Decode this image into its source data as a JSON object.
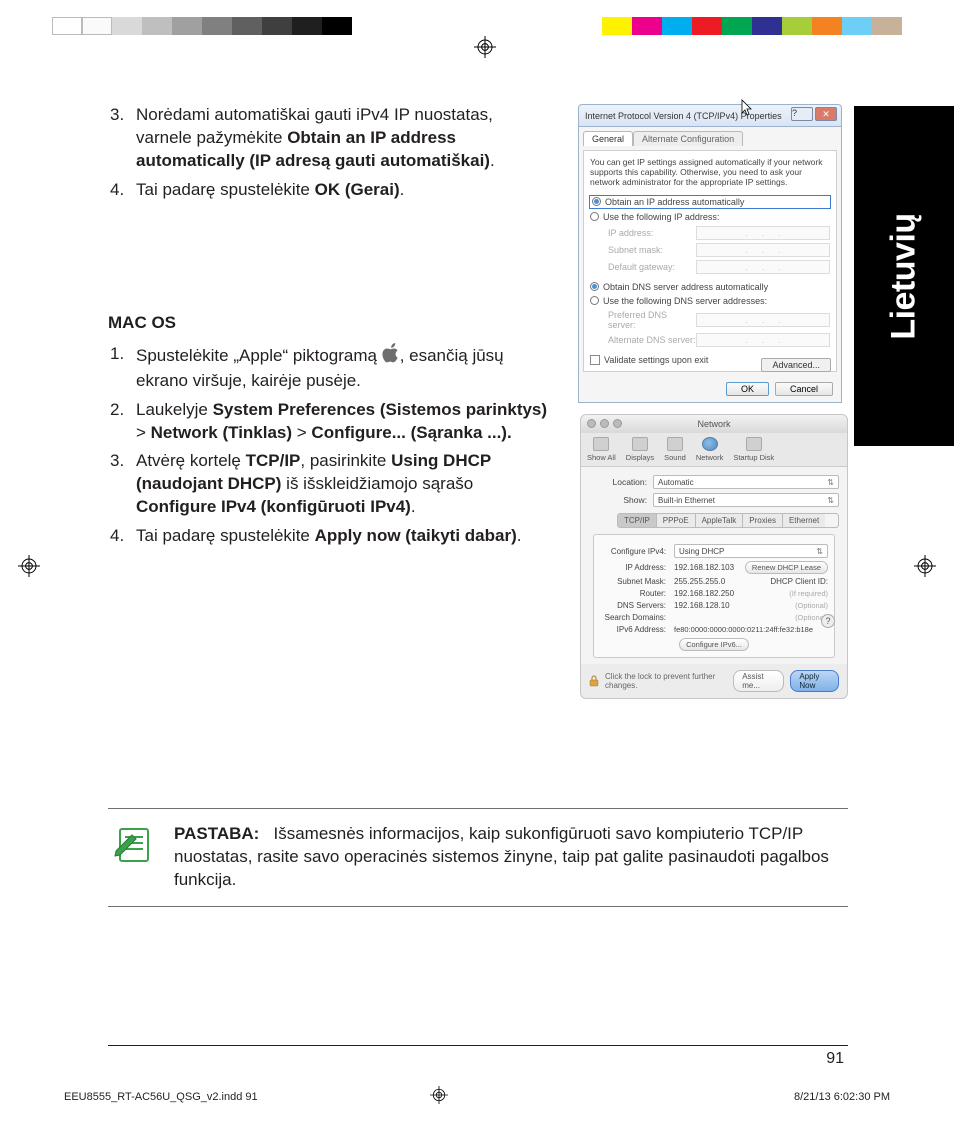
{
  "lang_tab": "Lietuvių",
  "section1": {
    "items": [
      {
        "num": "3.",
        "parts": [
          {
            "t": "Norėdami automatiškai gauti iPv4 IP nuostatas, varnele pažymėkite ",
            "b": false
          },
          {
            "t": "Obtain an IP address automatically (IP adresą gauti automatiškai)",
            "b": true
          },
          {
            "t": ".",
            "b": false
          }
        ]
      },
      {
        "num": "4.",
        "parts": [
          {
            "t": "Tai padarę spustelėkite ",
            "b": false
          },
          {
            "t": "OK (Gerai)",
            "b": true
          },
          {
            "t": ".",
            "b": false
          }
        ]
      }
    ]
  },
  "macos_heading": "MAC OS",
  "section2": {
    "items": [
      {
        "num": "1.",
        "parts": [
          {
            "t": "Spustelėkite „Apple“ piktogramą ",
            "b": false
          },
          {
            "icon": "apple"
          },
          {
            "t": ", esančią jūsų ekrano viršuje, kairėje pusėje.",
            "b": false
          }
        ]
      },
      {
        "num": "2.",
        "parts": [
          {
            "t": "Laukelyje ",
            "b": false
          },
          {
            "t": "System Preferences (Sistemos parinktys)",
            "b": true
          },
          {
            "t": " > ",
            "b": false
          },
          {
            "t": "Network (Tinklas)",
            "b": true
          },
          {
            "t": " > ",
            "b": false
          },
          {
            "t": "Configure... (Sąranka ...).",
            "b": true
          }
        ]
      },
      {
        "num": "3.",
        "parts": [
          {
            "t": "Atvėrę kortelę ",
            "b": false
          },
          {
            "t": "TCP/IP",
            "b": true
          },
          {
            "t": ", pasirinkite ",
            "b": false
          },
          {
            "t": "Using DHCP (naudojant DHCP)",
            "b": true
          },
          {
            "t": " iš išskleidžiamojo sąrašo ",
            "b": false
          },
          {
            "t": "Configure IPv4 (konfigūruoti IPv4)",
            "b": true
          },
          {
            "t": ".",
            "b": false
          }
        ]
      },
      {
        "num": "4.",
        "parts": [
          {
            "t": "Tai padarę spustelėkite ",
            "b": false
          },
          {
            "t": "Apply now (taikyti dabar)",
            "b": true
          },
          {
            "t": ".",
            "b": false
          }
        ]
      }
    ]
  },
  "note": {
    "label": "PASTABA:",
    "text": "Išsamesnės informacijos, kaip sukonfigūruoti savo kompiuterio TCP/IP nuostatas, rasite savo operacinės sistemos žinyne, taip pat galite pasinaudoti pagalbos funkcija."
  },
  "win_dialog": {
    "title": "Internet Protocol Version 4 (TCP/IPv4) Properties",
    "tabs": [
      "General",
      "Alternate Configuration"
    ],
    "desc": "You can get IP settings assigned automatically if your network supports this capability. Otherwise, you need to ask your network administrator for the appropriate IP settings.",
    "r1": "Obtain an IP address automatically",
    "r2": "Use the following IP address:",
    "f_ip": "IP address:",
    "f_mask": "Subnet mask:",
    "f_gw": "Default gateway:",
    "r3": "Obtain DNS server address automatically",
    "r4": "Use the following DNS server addresses:",
    "f_dns1": "Preferred DNS server:",
    "f_dns2": "Alternate DNS server:",
    "validate": "Validate settings upon exit",
    "advanced": "Advanced...",
    "ok": "OK",
    "cancel": "Cancel"
  },
  "mac_dialog": {
    "title": "Network",
    "toolbar": [
      "Show All",
      "Displays",
      "Sound",
      "Network",
      "Startup Disk"
    ],
    "location_lbl": "Location:",
    "location_val": "Automatic",
    "show_lbl": "Show:",
    "show_val": "Built-in Ethernet",
    "tabs": [
      "TCP/IP",
      "PPPoE",
      "AppleTalk",
      "Proxies",
      "Ethernet"
    ],
    "cfg_lbl": "Configure IPv4:",
    "cfg_val": "Using DHCP",
    "ip_lbl": "IP Address:",
    "ip_val": "192.168.182.103",
    "renew": "Renew DHCP Lease",
    "mask_lbl": "Subnet Mask:",
    "mask_val": "255.255.255.0",
    "clid_lbl": "DHCP Client ID:",
    "router_lbl": "Router:",
    "router_val": "192.168.182.250",
    "ifreq": "(If required)",
    "dns_lbl": "DNS Servers:",
    "dns_val": "192.168.128.10",
    "optional": "(Optional)",
    "search_lbl": "Search Domains:",
    "v6_lbl": "IPv6 Address:",
    "v6_val": "fe80:0000:0000:0000:0211:24ff:fe32:b18e",
    "cfg6": "Configure IPv6...",
    "lock_text": "Click the lock to prevent further changes.",
    "assist": "Assist me...",
    "apply": "Apply Now"
  },
  "page_number": "91",
  "slug_left": "EEU8555_RT-AC56U_QSG_v2.indd   91",
  "slug_right": "8/21/13   6:02:30 PM",
  "colorbar_left": [
    "#ffffff",
    "#fafafa",
    "#d9d9d9",
    "#bfbfbf",
    "#a0a0a0",
    "#808080",
    "#606060",
    "#3f3f3f",
    "#1f1f1f",
    "#000000"
  ],
  "colorbar_right": [
    "#fff200",
    "#ec008c",
    "#00aeef",
    "#ed1c24",
    "#00a651",
    "#2e3192",
    "#a6ce39",
    "#f58220",
    "#6dcff6",
    "#c7b299"
  ]
}
